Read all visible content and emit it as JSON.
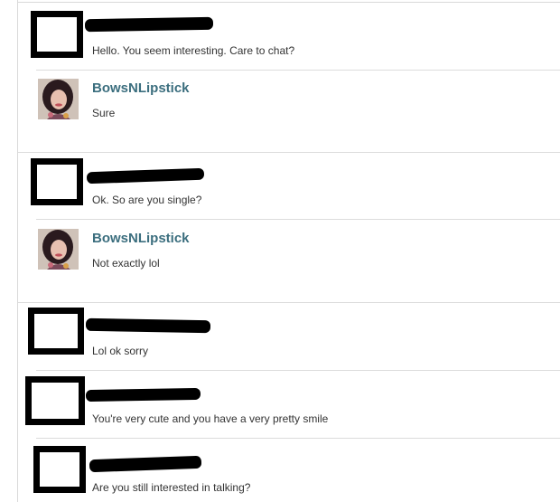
{
  "thread": {
    "messages": [
      {
        "sender": "redacted",
        "text": "Hello. You seem interesting. Care to chat?"
      },
      {
        "sender": "BowsNLipstick",
        "text": "Sure"
      },
      {
        "sender": "redacted",
        "text": "Ok. So are you single?"
      },
      {
        "sender": "BowsNLipstick",
        "text": "Not exactly lol"
      },
      {
        "sender": "redacted",
        "text": "Lol ok sorry"
      },
      {
        "sender": "redacted",
        "text": "You're very cute and you have a very pretty smile"
      },
      {
        "sender": "redacted",
        "text": "Are you still interested in talking?"
      }
    ]
  },
  "colors": {
    "username": "#3b6e7e",
    "message_text": "#333333",
    "separator": "#dcdcdc",
    "redaction": "#000000"
  }
}
